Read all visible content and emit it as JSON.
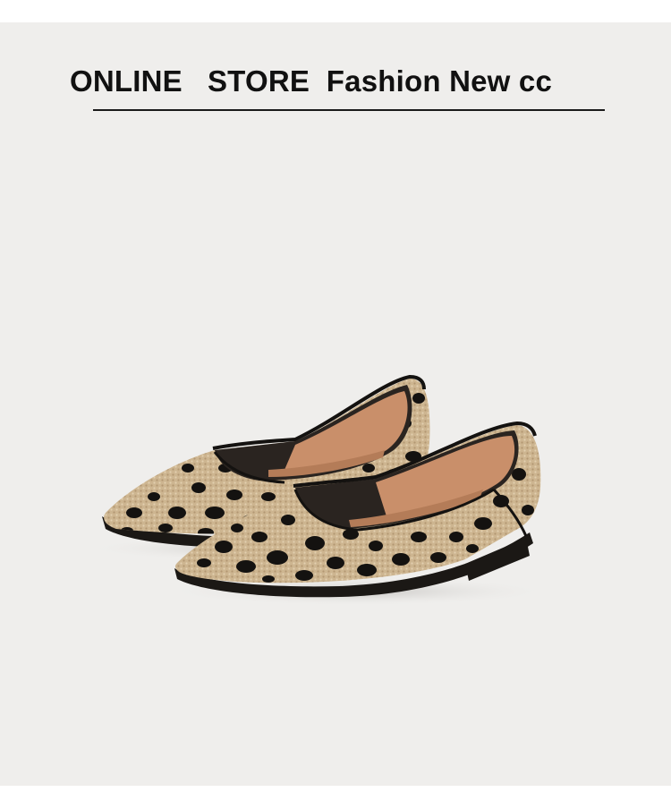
{
  "header": {
    "title": "ONLINE   STORE  Fashion New cc"
  },
  "product_image": {
    "subject": "leopard-print knit pointed-toe flats pair",
    "colors": {
      "background": "#efeeec",
      "knit_base": "#c9b08c",
      "spots": "#141210",
      "trim": "#141210",
      "insole": "#c98f6a"
    }
  }
}
